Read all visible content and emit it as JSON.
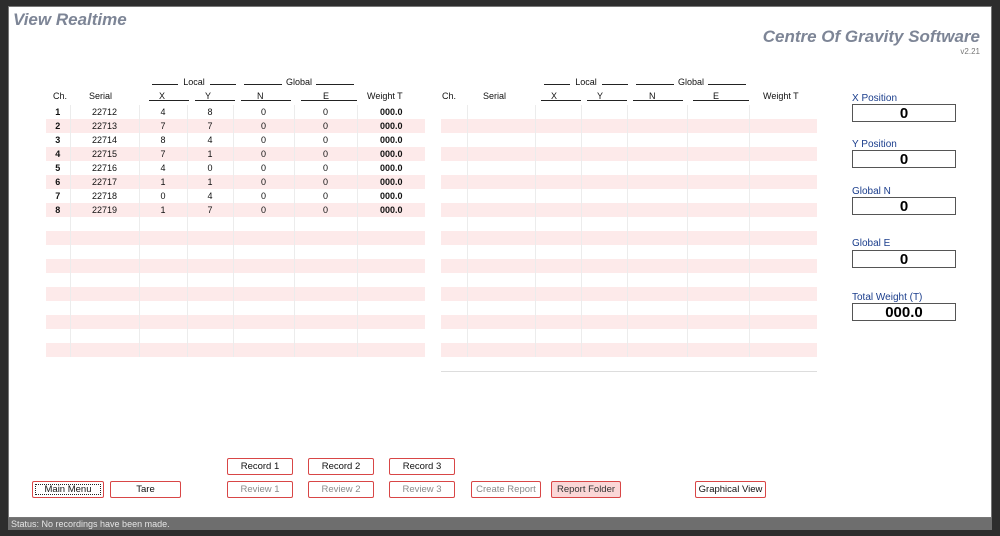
{
  "window_title": "View Realtime",
  "app_title": "Centre Of Gravity Software",
  "version": "v2.21",
  "table_headers": {
    "group_local": "Local",
    "group_global": "Global",
    "ch": "Ch.",
    "serial": "Serial",
    "x": "X",
    "y": "Y",
    "n": "N",
    "e": "E",
    "weight": "Weight T"
  },
  "left_table_rows": [
    [
      "1",
      "22712",
      "4",
      "8",
      "0",
      "0",
      "000.0"
    ],
    [
      "2",
      "22713",
      "7",
      "7",
      "0",
      "0",
      "000.0"
    ],
    [
      "3",
      "22714",
      "8",
      "4",
      "0",
      "0",
      "000.0"
    ],
    [
      "4",
      "22715",
      "7",
      "1",
      "0",
      "0",
      "000.0"
    ],
    [
      "5",
      "22716",
      "4",
      "0",
      "0",
      "0",
      "000.0"
    ],
    [
      "6",
      "22717",
      "1",
      "1",
      "0",
      "0",
      "000.0"
    ],
    [
      "7",
      "22718",
      "0",
      "4",
      "0",
      "0",
      "000.0"
    ],
    [
      "8",
      "22719",
      "1",
      "7",
      "0",
      "0",
      "000.0"
    ],
    [
      "",
      "",
      "",
      "",
      "",
      "",
      ""
    ],
    [
      "",
      "",
      "",
      "",
      "",
      "",
      ""
    ],
    [
      "",
      "",
      "",
      "",
      "",
      "",
      ""
    ],
    [
      "",
      "",
      "",
      "",
      "",
      "",
      ""
    ],
    [
      "",
      "",
      "",
      "",
      "",
      "",
      ""
    ],
    [
      "",
      "",
      "",
      "",
      "",
      "",
      ""
    ],
    [
      "",
      "",
      "",
      "",
      "",
      "",
      ""
    ],
    [
      "",
      "",
      "",
      "",
      "",
      "",
      ""
    ],
    [
      "",
      "",
      "",
      "",
      "",
      "",
      ""
    ],
    [
      "",
      "",
      "",
      "",
      "",
      "",
      ""
    ]
  ],
  "right_table_rows": [
    [
      "",
      "",
      "",
      "",
      "",
      "",
      ""
    ],
    [
      "",
      "",
      "",
      "",
      "",
      "",
      ""
    ],
    [
      "",
      "",
      "",
      "",
      "",
      "",
      ""
    ],
    [
      "",
      "",
      "",
      "",
      "",
      "",
      ""
    ],
    [
      "",
      "",
      "",
      "",
      "",
      "",
      ""
    ],
    [
      "",
      "",
      "",
      "",
      "",
      "",
      ""
    ],
    [
      "",
      "",
      "",
      "",
      "",
      "",
      ""
    ],
    [
      "",
      "",
      "",
      "",
      "",
      "",
      ""
    ],
    [
      "",
      "",
      "",
      "",
      "",
      "",
      ""
    ],
    [
      "",
      "",
      "",
      "",
      "",
      "",
      ""
    ],
    [
      "",
      "",
      "",
      "",
      "",
      "",
      ""
    ],
    [
      "",
      "",
      "",
      "",
      "",
      "",
      ""
    ],
    [
      "",
      "",
      "",
      "",
      "",
      "",
      ""
    ],
    [
      "",
      "",
      "",
      "",
      "",
      "",
      ""
    ],
    [
      "",
      "",
      "",
      "",
      "",
      "",
      ""
    ],
    [
      "",
      "",
      "",
      "",
      "",
      "",
      ""
    ],
    [
      "",
      "",
      "",
      "",
      "",
      "",
      ""
    ],
    [
      "",
      "",
      "",
      "",
      "",
      "",
      ""
    ]
  ],
  "side_panel": {
    "x_label": "X Position",
    "x_value": "0",
    "y_label": "Y Position",
    "y_value": "0",
    "n_label": "Global N",
    "n_value": "0",
    "e_label": "Global E",
    "e_value": "0",
    "w_label": "Total Weight (T)",
    "w_value": "000.0"
  },
  "buttons": {
    "record1": "Record 1",
    "record2": "Record 2",
    "record3": "Record 3",
    "main_menu": "Main Menu",
    "tare": "Tare",
    "review1": "Review 1",
    "review2": "Review 2",
    "review3": "Review 3",
    "create_report": "Create Report",
    "report_folder": "Report Folder",
    "graphical_view": "Graphical View"
  },
  "status": "Status: No recordings have been made.",
  "colors": {
    "title": "#7d8596",
    "row_alt": "#fdeaea",
    "button_border": "#d84646",
    "side_label": "#1a3d8c"
  }
}
